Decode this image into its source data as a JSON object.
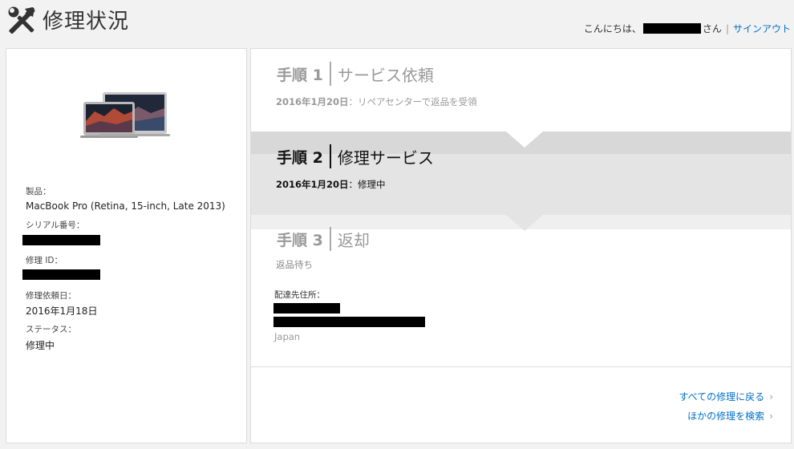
{
  "header": {
    "title": "修理状況",
    "greeting_prefix": "こんにちは、",
    "greeting_suffix": "さん",
    "separator": "|",
    "signout": "サインアウト"
  },
  "device": {
    "product_label": "製品：",
    "product_value": "MacBook Pro (Retina, 15-inch, Late 2013)",
    "serial_label": "シリアル番号：",
    "repair_id_label": "修理 ID：",
    "request_date_label": "修理依頼日：",
    "request_date_value": "2016年1月18日",
    "status_label": "ステータス：",
    "status_value": "修理中"
  },
  "steps": [
    {
      "num": "手順 1",
      "name": "サービス依頼",
      "date": "2016年1月20日",
      "detail": "：リペアセンターで返品を受領"
    },
    {
      "num": "手順 2",
      "name": "修理サービス",
      "date": "2016年1月20日",
      "detail": "：修理中"
    },
    {
      "num": "手順 3",
      "name": "返却",
      "status": "返品待ち",
      "address_label": "配達先住所：",
      "country": "Japan"
    }
  ],
  "links": {
    "all_repairs": "すべての修理に戻る",
    "search_other": "ほかの修理を検索",
    "chevron": "›"
  },
  "colors": {
    "link": "#0070c9",
    "active_band": "#e4e4e4"
  }
}
